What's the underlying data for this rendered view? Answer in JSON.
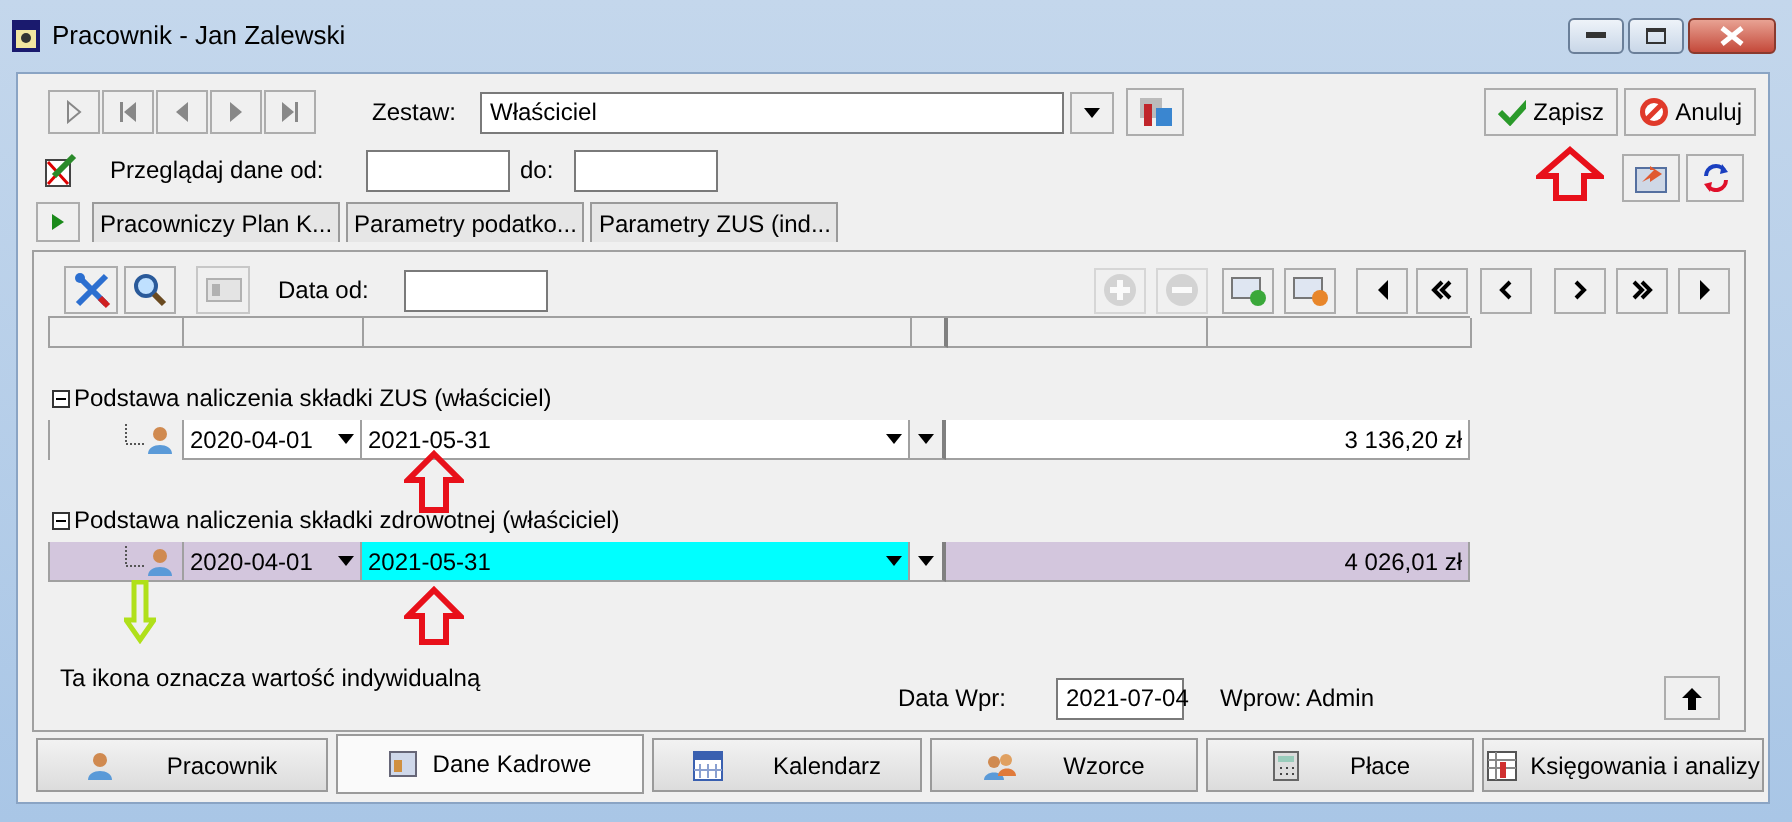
{
  "window": {
    "title": "Pracownik - Jan Zalewski"
  },
  "set": {
    "label": "Zestaw:",
    "value": "Właściciel"
  },
  "actions": [
    {
      "label": "Zapisz",
      "kind": "save"
    },
    {
      "label": "Anuluj",
      "kind": "cancel"
    }
  ],
  "browse": {
    "label": "Przeglądaj dane od:",
    "to_label": "do:"
  },
  "top_tabs": [
    {
      "label": "Pracowniczy Plan K..."
    },
    {
      "label": "Parametry podatko..."
    },
    {
      "label": "Parametry ZUS (ind..."
    }
  ],
  "panel": {
    "date_from_label": "Data od:",
    "groups": [
      {
        "title": "Podstawa naliczenia składki ZUS (właściciel)",
        "row": {
          "from": "2020-04-01",
          "to": "2021-05-31",
          "amount": "3 136,20 zł",
          "selected": false
        }
      },
      {
        "title": "Podstawa naliczenia składki zdrowotnej (właściciel)",
        "row": {
          "from": "2020-04-01",
          "to": "2021-05-31",
          "amount": "4 026,01 zł",
          "selected": true
        }
      }
    ],
    "note": "Ta ikona oznacza wartość indywidualną",
    "entry_date_label": "Data Wpr:",
    "entry_date": "2021-07-04",
    "entered_by_label": "Wprow:",
    "entered_by": "Admin"
  },
  "bottom_tabs": [
    {
      "label": "Pracownik",
      "kind": "person",
      "selected": false
    },
    {
      "label": "Dane Kadrowe",
      "kind": "card",
      "selected": true
    },
    {
      "label": "Kalendarz",
      "kind": "calendar",
      "selected": false
    },
    {
      "label": "Wzorce",
      "kind": "people",
      "selected": false
    },
    {
      "label": "Płace",
      "kind": "calculator",
      "selected": false
    },
    {
      "label": "Księgowania i analizy",
      "kind": "ledger",
      "selected": false
    }
  ]
}
